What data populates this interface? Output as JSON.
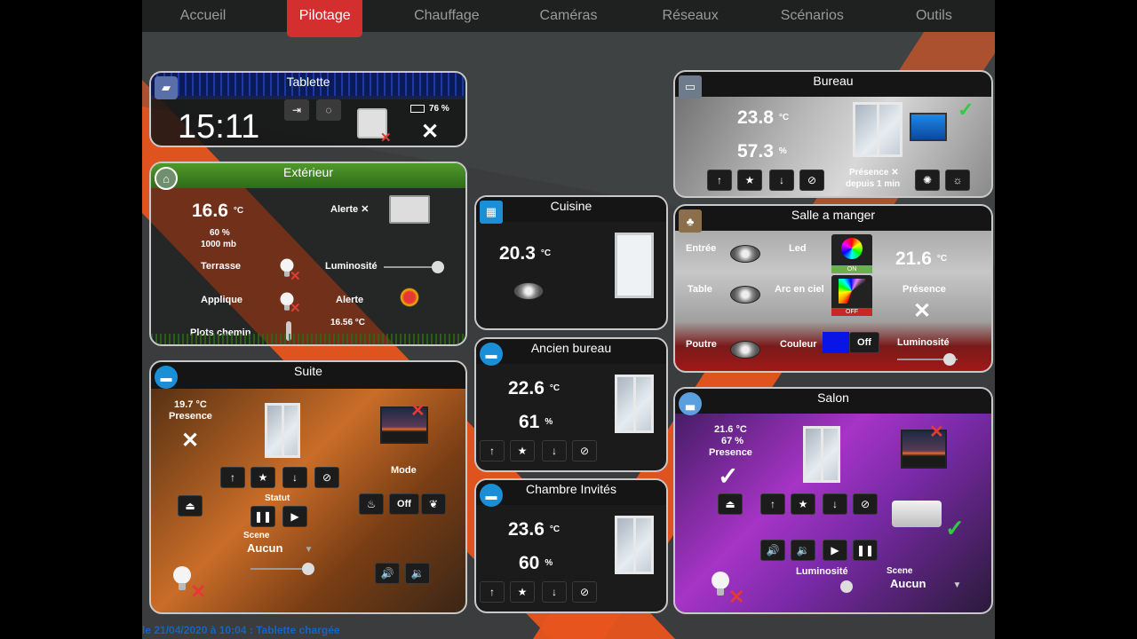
{
  "nav": {
    "items": [
      {
        "label": "Accueil",
        "active": false
      },
      {
        "label": "Pilotage",
        "active": true
      },
      {
        "label": "Chauffage",
        "active": false
      },
      {
        "label": "Caméras",
        "active": false
      },
      {
        "label": "Réseaux",
        "active": false
      },
      {
        "label": "Scénarios",
        "active": false
      },
      {
        "label": "Outils",
        "active": false
      }
    ]
  },
  "colors": {
    "accent": "#d32f2f",
    "orange": "#e8541e",
    "blue_icon": "#1a8fd8",
    "status_blue": "#1565c0",
    "check_green": "#2ecc40",
    "cross_red": "#e53935"
  },
  "tablette": {
    "title": "Tablette",
    "time": "15:11",
    "battery": "76 %"
  },
  "exterieur": {
    "title": "Extérieur",
    "temp": "16.6",
    "unit": "°C",
    "humidity": "60 %",
    "pressure": "1000 mb",
    "alert": "Alerte ✕",
    "terrasse": "Terrasse",
    "luminosite": "Luminosité",
    "applique": "Applique",
    "alerte": "Alerte",
    "alert_temp": "16.56 °C",
    "plots": "Plots chemin"
  },
  "cuisine": {
    "title": "Cuisine",
    "temp": "20.3",
    "unit": "°C"
  },
  "ancien_bureau": {
    "title": "Ancien bureau",
    "temp": "22.6",
    "unit": "°C",
    "hum": "61",
    "hum_unit": "%"
  },
  "chambre": {
    "title": "Chambre Invités",
    "temp": "23.6",
    "unit": "°C",
    "hum": "60",
    "hum_unit": "%"
  },
  "bureau": {
    "title": "Bureau",
    "temp": "23.8",
    "unit": "°C",
    "hum": "57.3",
    "hum_unit": "%",
    "presence": "Présence ✕",
    "since": "depuis 1 min"
  },
  "salle": {
    "title": "Salle a manger",
    "entree": "Entrée",
    "led": "Led",
    "led_on": "ON",
    "table": "Table",
    "arc": "Arc en ciel",
    "arc_off": "OFF",
    "temp": "21.6",
    "unit": "°C",
    "presence": "Présence",
    "poutre": "Poutre",
    "couleur": "Couleur",
    "couleur_state": "Off",
    "luminosite": "Luminosité"
  },
  "suite": {
    "title": "Suite",
    "temp": "19.7 °C",
    "presence": "Presence",
    "mode": "Mode",
    "statut": "Statut",
    "off": "Off",
    "scene_label": "Scene",
    "scene": "Aucun"
  },
  "salon": {
    "title": "Salon",
    "temp": "21.6 °C",
    "hum": "67 %",
    "presence": "Presence",
    "luminosite": "Luminosité",
    "scene_label": "Scene",
    "scene": "Aucun"
  },
  "status": {
    "text": "le 21/04/2020 à 10:04 : Tablette chargée"
  },
  "icons": {
    "up": "arrow-up-icon",
    "favorite": "star-icon",
    "down": "arrow-down-icon",
    "stop": "stop-icon"
  }
}
